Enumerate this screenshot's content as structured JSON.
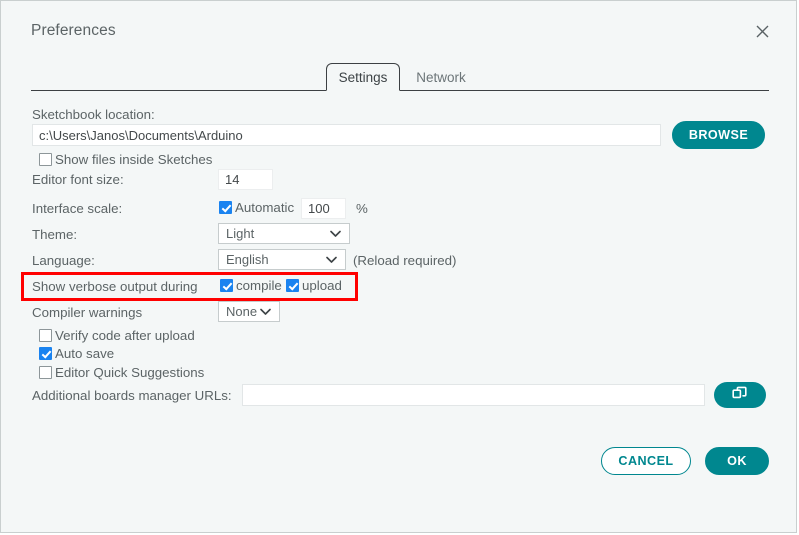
{
  "dialog": {
    "title": "Preferences",
    "close_icon": "close-icon"
  },
  "tabs": [
    {
      "label": "Settings",
      "active": true
    },
    {
      "label": "Network",
      "active": false
    }
  ],
  "settings": {
    "sketchbook_label": "Sketchbook location:",
    "sketchbook_value": "c:\\Users\\Janos\\Documents\\Arduino",
    "sketchbook_placeholder": "",
    "browse_label": "BROWSE",
    "show_files_inside_sketches": {
      "label": "Show files inside Sketches",
      "checked": false
    },
    "editor_font_size_label": "Editor font size:",
    "editor_font_size_value": "14",
    "interface_scale_label": "Interface scale:",
    "automatic_label": "Automatic",
    "automatic_checked": true,
    "interface_scale_value": "100",
    "percent_symbol": "%",
    "theme_label": "Theme:",
    "theme_value": "Light",
    "language_label": "Language:",
    "language_value": "English",
    "reload_note": "(Reload required)",
    "verbose_label": "Show verbose output during",
    "verbose_compile": {
      "label": "compile",
      "checked": true
    },
    "verbose_upload": {
      "label": "upload",
      "checked": true
    },
    "compiler_warnings_label": "Compiler warnings",
    "compiler_warnings_value": "None",
    "verify_code": {
      "label": "Verify code after upload",
      "checked": false
    },
    "auto_save": {
      "label": "Auto save",
      "checked": true
    },
    "quick_suggestions": {
      "label": "Editor Quick Suggestions",
      "checked": false
    },
    "boards_urls_label": "Additional boards manager URLs:",
    "boards_urls_value": "",
    "boards_urls_icon": "open-window-icon"
  },
  "footer": {
    "cancel_label": "CANCEL",
    "ok_label": "OK"
  },
  "colors": {
    "accent_teal": "#00878f",
    "checkbox_blue": "#1a83f0",
    "highlight_red": "#ff0000",
    "dialog_bg": "#f4f7f7",
    "text": "#5c6466"
  }
}
